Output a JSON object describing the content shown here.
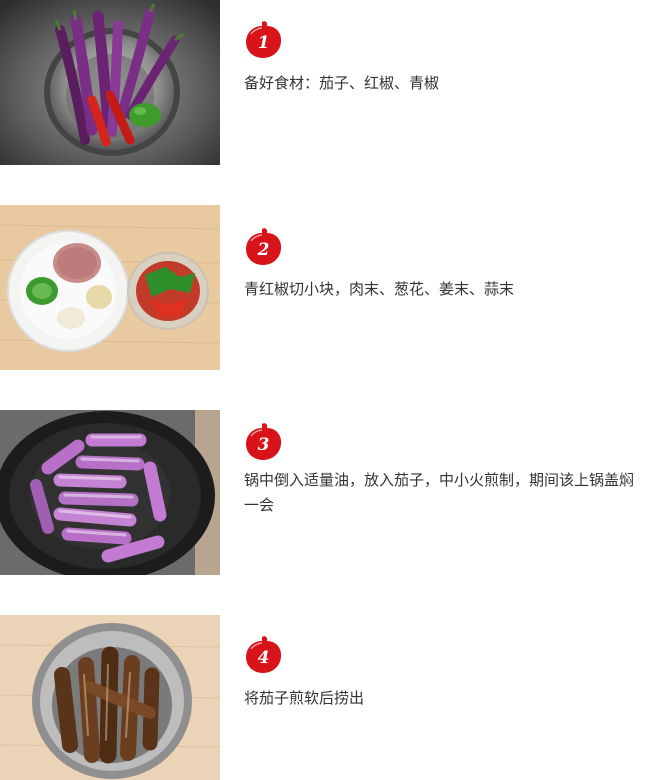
{
  "steps": [
    {
      "number": "1",
      "text": "备好食材：茄子、红椒、青椒",
      "image": "eggplants-and-peppers-in-sink-colander"
    },
    {
      "number": "2",
      "text": "青红椒切小块，肉末、葱花、姜末、蒜末",
      "image": "minced-ingredients-on-plate-and-bowl"
    },
    {
      "number": "3",
      "text": "锅中倒入适量油，放入茄子，中小火煎制，期间该上锅盖焖一会",
      "image": "eggplant-pieces-frying-in-wok"
    },
    {
      "number": "4",
      "text": "将茄子煎软后捞出",
      "image": "fried-eggplant-in-steel-bowl"
    }
  ],
  "colors": {
    "badge_red": "#d9131a",
    "text": "#333333"
  }
}
